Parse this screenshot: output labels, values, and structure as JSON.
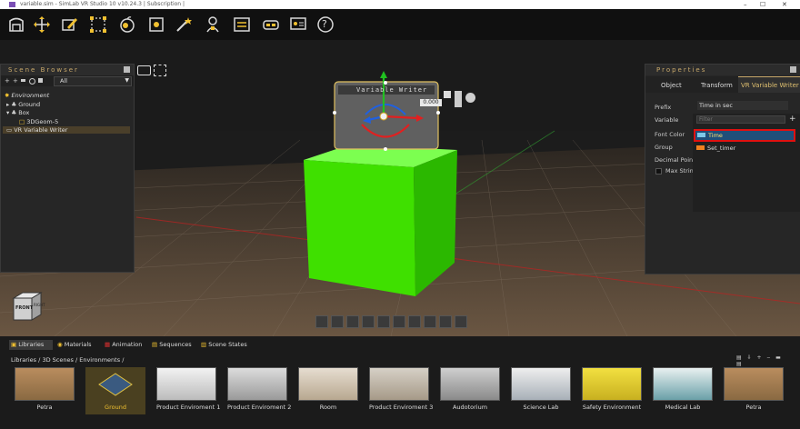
{
  "window": {
    "title": "variable.sim - SimLab VR Studio 10 v10.24.3 | Subscription |",
    "minimize": "–",
    "maximize": "☐",
    "close": "✕"
  },
  "toolbar": {
    "icons": [
      "home-icon",
      "move-icon",
      "edit-icon",
      "select-box-icon",
      "apple-icon",
      "import-icon",
      "magic-wand-icon",
      "person-icon",
      "list-icon",
      "vr-headset-icon",
      "presentation-icon",
      "help-icon"
    ],
    "help_label": "?"
  },
  "scene_browser": {
    "title": "Scene Browser",
    "filter_value": "All",
    "items": [
      {
        "label": "Environment"
      },
      {
        "label": "Ground"
      },
      {
        "label": "Box"
      },
      {
        "label": "3DGeom-5"
      },
      {
        "label": "VR Variable Writer"
      }
    ]
  },
  "viewport": {
    "billboard_title": "Variable Writer",
    "billboard_value": "0.000",
    "cube_labels": {
      "front": "FRONT",
      "right": "RIGHT"
    }
  },
  "properties": {
    "title": "Properties",
    "tabs": [
      {
        "label": "Object"
      },
      {
        "label": "Transform"
      },
      {
        "label": "VR Variable Writer"
      }
    ],
    "rows": [
      {
        "label": "Prefix"
      },
      {
        "label": "Variable"
      },
      {
        "label": "Font Color"
      },
      {
        "label": "Group"
      },
      {
        "label": "Decimal Points"
      },
      {
        "label": "Max String"
      }
    ],
    "prefix_value": "Time in sec",
    "filter_placeholder": "Filter",
    "add_label": "+",
    "dropdown_items": [
      {
        "label": "Time",
        "selected": true
      },
      {
        "label": "Set_timer",
        "selected": false
      }
    ]
  },
  "bottom": {
    "tabs": [
      {
        "label": "Libraries"
      },
      {
        "label": "Materials"
      },
      {
        "label": "Animation"
      },
      {
        "label": "Sequences"
      },
      {
        "label": "Scene States"
      }
    ],
    "breadcrumb": [
      "Libraries",
      "/",
      "3D Scenes",
      "/",
      "Environments",
      "/"
    ],
    "thumbnails": [
      {
        "label": "Petra"
      },
      {
        "label": "Ground"
      },
      {
        "label": "Product Enviroment 1"
      },
      {
        "label": "Product Enviroment 2"
      },
      {
        "label": "Room"
      },
      {
        "label": "Product Enviroment 3"
      },
      {
        "label": "Audotorium"
      },
      {
        "label": "Science Lab"
      },
      {
        "label": "Safety Environment"
      },
      {
        "label": "Medical Lab"
      },
      {
        "label": "Petra"
      }
    ]
  },
  "colors": {
    "accent": "#c8a86a",
    "cube": "#33dd00",
    "selection_outline": "#e01010",
    "selected_highlight": "#1f4f7a"
  }
}
